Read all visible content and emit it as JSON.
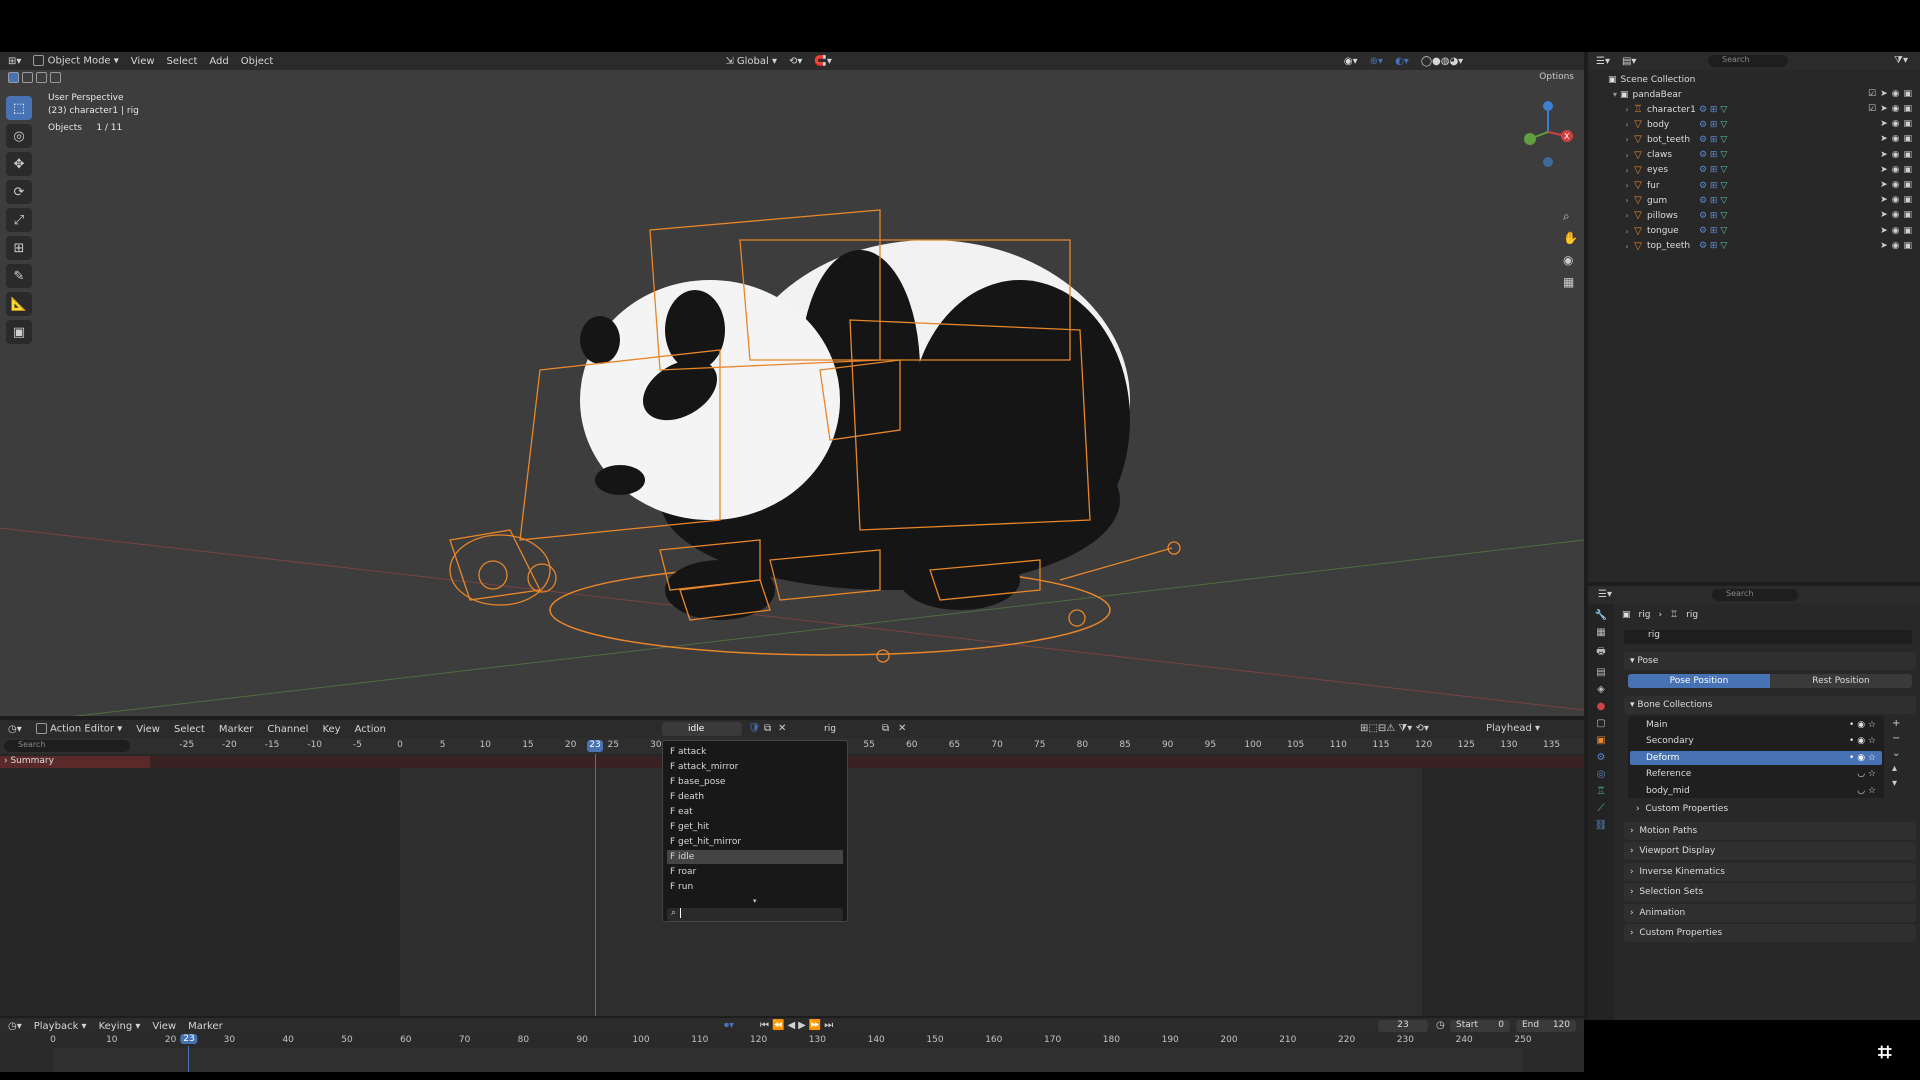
{
  "viewport_header": {
    "mode": "Object Mode",
    "menus": [
      "View",
      "Select",
      "Add",
      "Object"
    ],
    "transform_orientation": "Global",
    "options_label": "Options"
  },
  "viewport_overlay": {
    "perspective": "User Perspective",
    "active": "(23) character1 | rig",
    "objects_label": "Objects",
    "objects_count": "1 / 11"
  },
  "outliner": {
    "search_placeholder": "Search",
    "scene_collection": "Scene Collection",
    "collection": "pandaBear",
    "items": [
      "character1",
      "body",
      "bot_teeth",
      "claws",
      "eyes",
      "fur",
      "gum",
      "pillows",
      "tongue",
      "top_teeth"
    ]
  },
  "properties": {
    "search_placeholder": "Search",
    "breadcrumb": [
      "rig",
      "rig"
    ],
    "datablock": "rig",
    "pose_panel": "Pose",
    "pose_position": "Pose Position",
    "rest_position": "Rest Position",
    "bone_collections_panel": "Bone Collections",
    "bone_collections": [
      "Main",
      "Secondary",
      "Deform",
      "Reference",
      "body_mid"
    ],
    "active_bone_collection": "Deform",
    "custom_properties_sub": "Custom Properties",
    "panels": [
      "Motion Paths",
      "Viewport Display",
      "Inverse Kinematics",
      "Selection Sets",
      "Animation",
      "Custom Properties"
    ]
  },
  "action_editor": {
    "editor": "Action Editor",
    "menus": [
      "View",
      "Select",
      "Marker",
      "Channel",
      "Key",
      "Action"
    ],
    "action_name": "idle",
    "slot_name": "rig",
    "playhead_label": "Playhead",
    "search_placeholder": "Search",
    "summary": "Summary",
    "ruler": [
      "-25",
      "-20",
      "-15",
      "-10",
      "-5",
      "0",
      "5",
      "10",
      "15",
      "20",
      "25",
      "30",
      "55",
      "60",
      "65",
      "70",
      "75",
      "80",
      "85",
      "90",
      "95",
      "100",
      "105",
      "110",
      "115",
      "120",
      "125",
      "130",
      "135"
    ],
    "current_frame": "23"
  },
  "action_dropdown": {
    "items": [
      "F attack",
      "F attack_mirror",
      "F base_pose",
      "F death",
      "F eat",
      "F get_hit",
      "F get_hit_mirror",
      "F idle",
      "F roar",
      "F run"
    ],
    "highlighted": "F idle"
  },
  "timeline": {
    "menus": [
      "Playback",
      "Keying",
      "View",
      "Marker"
    ],
    "ruler": [
      "0",
      "10",
      "20",
      "30",
      "40",
      "50",
      "60",
      "70",
      "80",
      "90",
      "100",
      "110",
      "120",
      "130",
      "140",
      "150",
      "160",
      "170",
      "180",
      "190",
      "200",
      "210",
      "220",
      "230",
      "240",
      "250"
    ],
    "current_frame": "23",
    "frame_field": "23",
    "start_label": "Start",
    "start_value": "0",
    "end_label": "End",
    "end_value": "120"
  },
  "colors": {
    "accent": "#4772b3",
    "rig_orange": "#e8862a",
    "summary_red": "#5a2a2a"
  }
}
